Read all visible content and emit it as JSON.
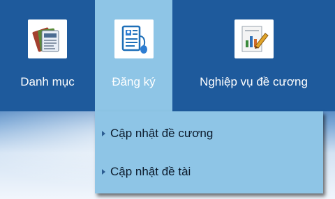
{
  "menubar": {
    "items": [
      {
        "label": "Danh mục",
        "icon": "newspapers-icon"
      },
      {
        "label": "Đăng ký",
        "icon": "id-card-mouse-icon"
      },
      {
        "label": "Nghiệp vụ đề cương",
        "icon": "document-chart-pencil-icon"
      }
    ]
  },
  "dropdown": {
    "items": [
      {
        "label": "Cập nhật đề cương"
      },
      {
        "label": "Cập nhật đề tài"
      }
    ]
  },
  "colors": {
    "menubar": "#1e5a9c",
    "active": "#8ec5e6",
    "dropdown": "#8ec5e6"
  }
}
